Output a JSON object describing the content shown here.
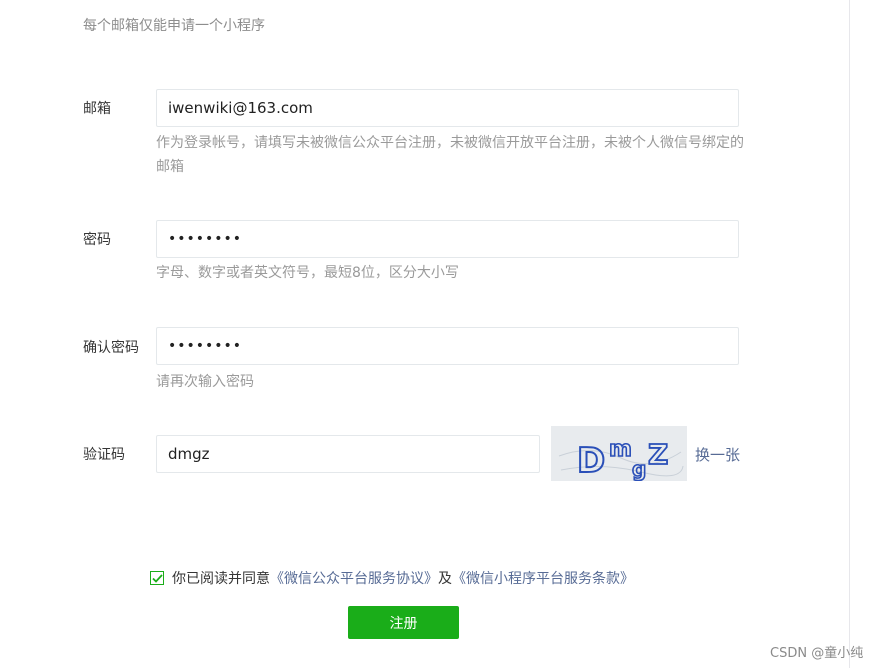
{
  "notice": "每个邮箱仅能申请一个小程序",
  "email": {
    "label": "邮箱",
    "value": "iwenwiki@163.com",
    "tip": "作为登录帐号，请填写未被微信公众平台注册，未被微信开放平台注册，未被个人微信号绑定的邮箱"
  },
  "password": {
    "label": "密码",
    "value": "••••••••",
    "tip": "字母、数字或者英文符号，最短8位，区分大小写"
  },
  "confirm_password": {
    "label": "确认密码",
    "value": "••••••••",
    "tip": "请再次输入密码"
  },
  "captcha": {
    "label": "验证码",
    "value": "dmgz",
    "image_text": "DmgZ",
    "refresh_label": "换一张"
  },
  "agreement": {
    "prefix": "你已阅读并同意",
    "link1": "《微信公众平台服务协议》",
    "joiner": "及",
    "link2": "《微信小程序平台服务条款》",
    "checked": true
  },
  "submit_label": "注册",
  "watermark": "CSDN @童小纯",
  "colors": {
    "accent": "#1aad19",
    "link": "#576b95",
    "captcha_ink": "#2a4fb8"
  }
}
